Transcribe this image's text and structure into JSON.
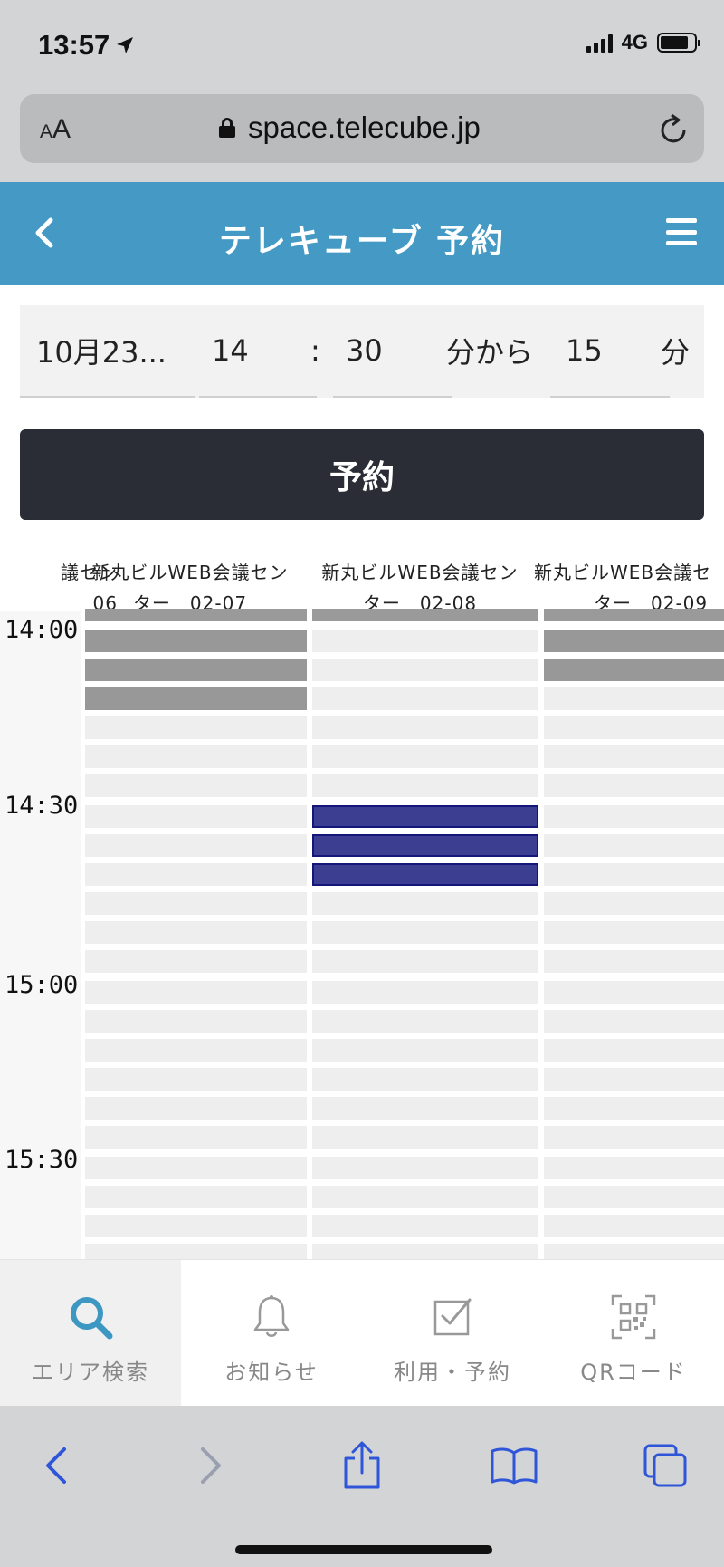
{
  "status_bar": {
    "time": "13:57",
    "network": "4G"
  },
  "browser": {
    "aa_small": "A",
    "aa_large": "A",
    "url": "space.telecube.jp"
  },
  "app": {
    "title": "テレキューブ 予約"
  },
  "form": {
    "date": "10月23...",
    "hour": "14",
    "separator": ":",
    "minute": "30",
    "from_label": "分から",
    "duration": "15",
    "duration_unit": "分",
    "reserve_label": "予約"
  },
  "schedule": {
    "columns": [
      {
        "line1": "議セン",
        "line2": "06"
      },
      {
        "line1": "新丸ビルWEB会議セン",
        "line2": "ター　02-07"
      },
      {
        "line1": "新丸ビルWEB会議セン",
        "line2": "ター　02-08"
      },
      {
        "line1": "新丸ビルWEB会議セ",
        "line2": "ター　02-09"
      }
    ],
    "times": [
      "14:00",
      "14:30",
      "15:00",
      "15:30"
    ]
  },
  "tabbar": {
    "items": [
      {
        "label": "エリア検索",
        "icon": "search-icon",
        "active": true
      },
      {
        "label": "お知らせ",
        "icon": "bell-icon",
        "active": false
      },
      {
        "label": "利用・予約",
        "icon": "checkbox-icon",
        "active": false
      },
      {
        "label": "QRコード",
        "icon": "qr-code-icon",
        "active": false
      }
    ]
  },
  "colors": {
    "header": "#449ac4",
    "reserve_button": "#2a2d35",
    "selected_slot": "#3c3f91",
    "taken_slot": "#989898",
    "active_tab_icon": "#3c97c2",
    "safari_icons": "#2f56d8"
  }
}
